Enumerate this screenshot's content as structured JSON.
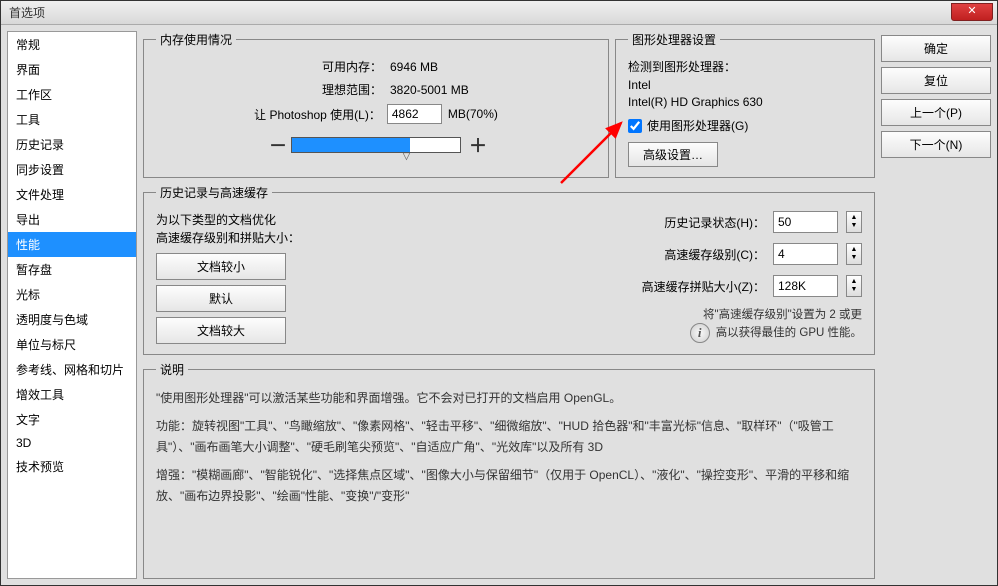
{
  "window": {
    "title": "首选项"
  },
  "sidebar": {
    "items": [
      {
        "label": "常规"
      },
      {
        "label": "界面"
      },
      {
        "label": "工作区"
      },
      {
        "label": "工具"
      },
      {
        "label": "历史记录"
      },
      {
        "label": "同步设置"
      },
      {
        "label": "文件处理"
      },
      {
        "label": "导出"
      },
      {
        "label": "性能",
        "selected": true
      },
      {
        "label": "暂存盘"
      },
      {
        "label": "光标"
      },
      {
        "label": "透明度与色域"
      },
      {
        "label": "单位与标尺"
      },
      {
        "label": "参考线、网格和切片"
      },
      {
        "label": "增效工具"
      },
      {
        "label": "文字"
      },
      {
        "label": "3D"
      },
      {
        "label": "技术预览"
      }
    ]
  },
  "memory": {
    "legend": "内存使用情况",
    "available_label": "可用内存：",
    "available_value": "6946 MB",
    "ideal_label": "理想范围：",
    "ideal_value": "3820-5001 MB",
    "use_label": "让 Photoshop 使用(L)：",
    "use_value": "4862",
    "use_suffix": "MB(70%)",
    "minus": "－",
    "plus": "＋"
  },
  "gpu": {
    "legend": "图形处理器设置",
    "detected_label": "检测到图形处理器：",
    "vendor": "Intel",
    "model": "Intel(R) HD Graphics 630",
    "use_gpu_label": "使用图形处理器(G)",
    "advanced_btn": "高级设置…"
  },
  "history": {
    "legend": "历史记录与高速缓存",
    "optimize_label": "为以下类型的文档优化",
    "cache_label": "高速缓存级别和拼贴大小：",
    "btns": {
      "small": "文档较小",
      "default": "默认",
      "large": "文档较大"
    },
    "states_label": "历史记录状态(H)：",
    "states_value": "50",
    "levels_label": "高速缓存级别(C)：",
    "levels_value": "4",
    "tile_label": "高速缓存拼贴大小(Z)：",
    "tile_value": "128K",
    "note1": "将\"高速缓存级别\"设置为 2 或更",
    "note2": "高以获得最佳的 GPU 性能。"
  },
  "desc": {
    "legend": "说明",
    "p1": "\"使用图形处理器\"可以激活某些功能和界面增强。它不会对已打开的文档启用 OpenGL。",
    "p2": "功能：旋转视图\"工具\"、\"鸟瞰缩放\"、\"像素网格\"、\"轻击平移\"、\"细微缩放\"、\"HUD 拾色器\"和\"丰富光标\"信息、\"取样环\"（\"吸管工具\"）、\"画布画笔大小调整\"、\"硬毛刷笔尖预览\"、\"自适应广角\"、\"光效库\"以及所有 3D",
    "p3": "增强：\"模糊画廊\"、\"智能锐化\"、\"选择焦点区域\"、\"图像大小与保留细节\"（仅用于 OpenCL）、\"液化\"、\"操控变形\"、平滑的平移和缩放、\"画布边界投影\"、\"绘画\"性能、\"变换\"/\"变形\""
  },
  "rightbar": {
    "ok": "确定",
    "reset": "复位",
    "prev": "上一个(P)",
    "next": "下一个(N)"
  }
}
